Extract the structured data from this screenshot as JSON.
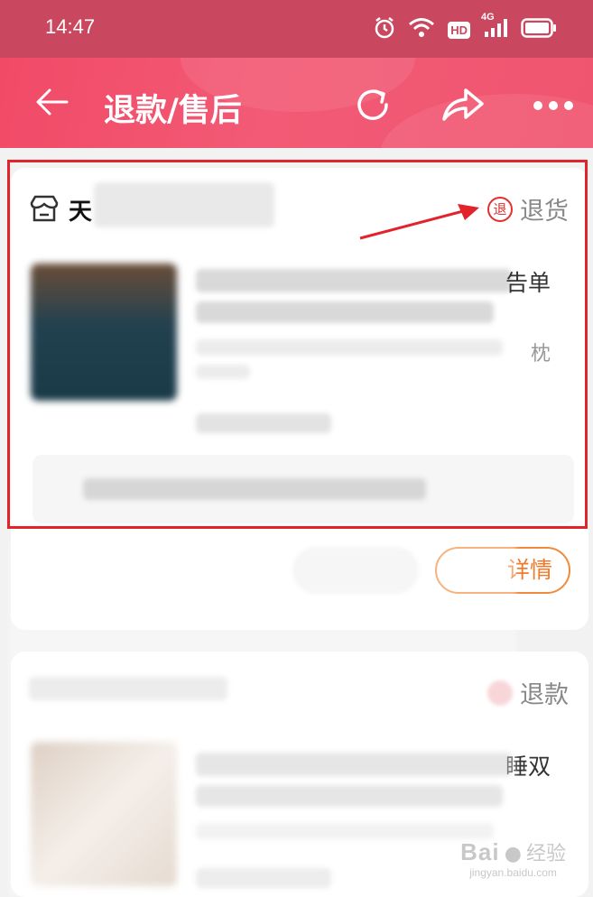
{
  "status_bar": {
    "time": "14:47",
    "network_badge": "HD",
    "cell_label": "4G"
  },
  "header": {
    "title": "退款/售后"
  },
  "orders": [
    {
      "store_name_visible": "天",
      "type_icon_char": "退",
      "type_label": "退货",
      "title_tail": "告单",
      "spec_tail": "枕",
      "detail_button_tail": "详情"
    },
    {
      "type_label": "退款",
      "title_tail": "睡双"
    }
  ],
  "watermark": {
    "brand": "Bai",
    "brand_cn": "经验",
    "url": "jingyan.baidu.com"
  },
  "colors": {
    "header_start": "#f14a67",
    "status_bar": "#c9475f",
    "highlight": "#e2232a",
    "refund_icon": "#e03030",
    "detail_button": "#f28a3c"
  }
}
